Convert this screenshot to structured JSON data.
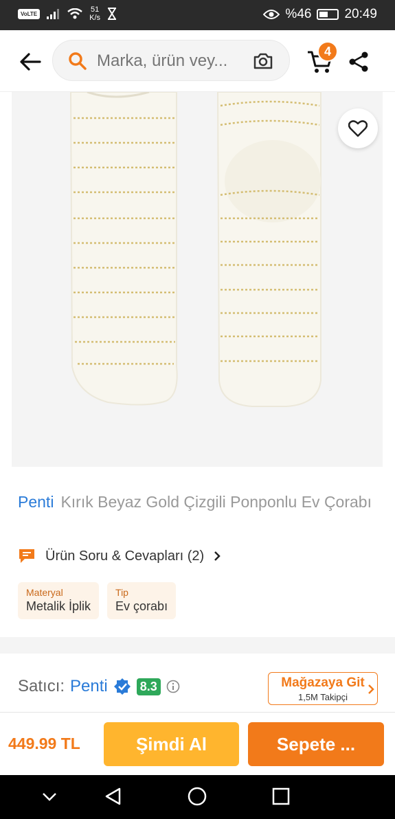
{
  "status_bar": {
    "volte": "VoLTE",
    "speed_value": "51",
    "speed_unit": "K/s",
    "battery_percent": "%46",
    "time": "20:49"
  },
  "top_bar": {
    "search_placeholder": "Marka, ürün vey...",
    "cart_count": "4"
  },
  "product": {
    "brand": "Penti",
    "title": "Kırık Beyaz Gold Çizgili Ponponlu Ev Çorabı",
    "qa_label": "Ürün Soru & Cevapları (2)",
    "attributes": [
      {
        "label": "Materyal",
        "value": "Metalik İplik"
      },
      {
        "label": "Tip",
        "value": "Ev çorabı"
      }
    ]
  },
  "seller": {
    "label": "Satıcı:",
    "name": "Penti",
    "score": "8.3",
    "store_button": "Mağazaya Git",
    "followers": "1,5M Takipçi"
  },
  "action_bar": {
    "price": "449.99 TL",
    "buy_now": "Şimdi Al",
    "add_to_cart": "Sepete ..."
  },
  "colors": {
    "accent": "#f27a1a",
    "buy_now": "#ffb52e",
    "link": "#2a7bd8",
    "score": "#2ea85a"
  }
}
